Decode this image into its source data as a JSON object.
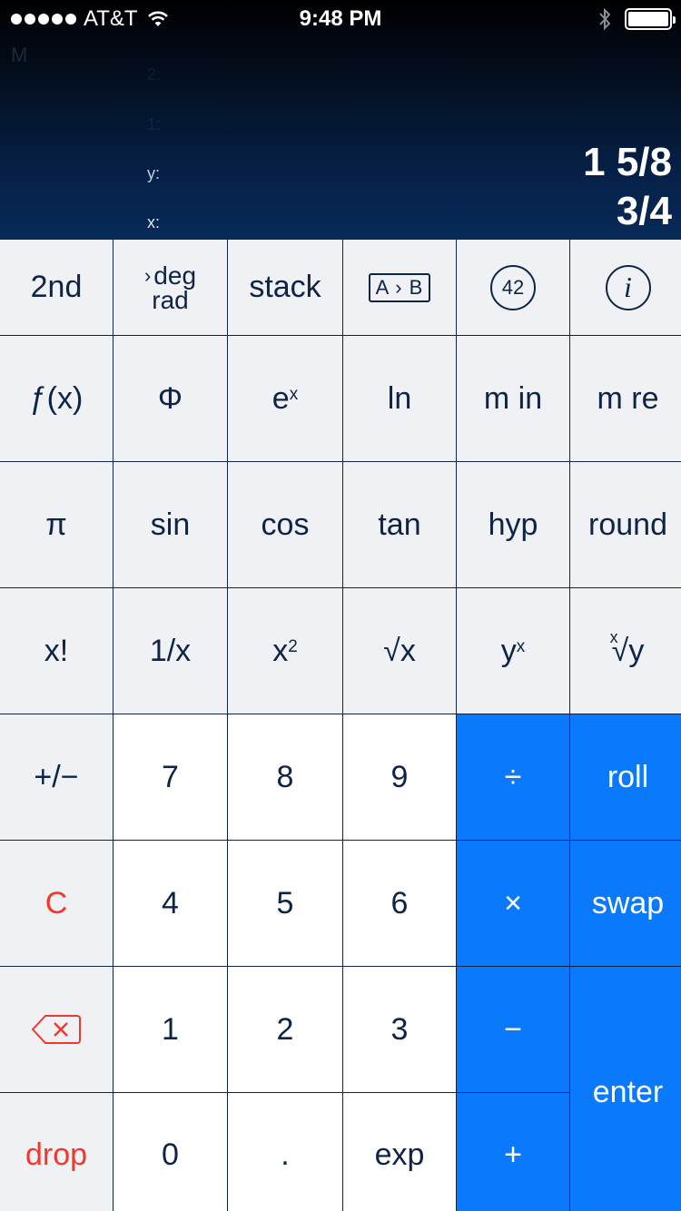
{
  "status_bar": {
    "carrier": "AT&T",
    "time": "9:48 PM",
    "icons": [
      "signal-dots-icon",
      "wifi-icon",
      "bluetooth-icon",
      "battery-icon"
    ]
  },
  "display": {
    "memory_indicator": "M",
    "registers": {
      "r2_label": "2:",
      "r1_label": "1:",
      "y_label": "y:",
      "x_label": "x:",
      "y_value": "1 5/8",
      "x_value": "3/4"
    }
  },
  "keys": {
    "second": "2nd",
    "deg": "deg",
    "rad": "rad",
    "stack": "stack",
    "a_to_b": "A › B",
    "forty_two": "42",
    "info": "i",
    "fx": "ƒ(x)",
    "phi": "Φ",
    "e": "e",
    "e_sup": "x",
    "ln": "ln",
    "m_in": "m in",
    "m_re": "m re",
    "pi": "π",
    "sin": "sin",
    "cos": "cos",
    "tan": "tan",
    "hyp": "hyp",
    "round": "round",
    "factorial": "x!",
    "reciprocal": "1/x",
    "square_base": "x",
    "square_sup": "2",
    "sqrt": "√x",
    "power_base": "y",
    "power_sup": "x",
    "nth_root_sup": "x",
    "nth_root_body": "√y",
    "plus_minus": "+/−",
    "seven": "7",
    "eight": "8",
    "nine": "9",
    "divide": "÷",
    "roll": "roll",
    "clear": "C",
    "four": "4",
    "five": "5",
    "six": "6",
    "multiply": "×",
    "swap": "swap",
    "one": "1",
    "two": "2",
    "three": "3",
    "minus": "−",
    "enter": "enter",
    "drop": "drop",
    "zero": "0",
    "dot": ".",
    "exp": "exp",
    "plus": "+"
  },
  "colors": {
    "accent": "#0a79fb",
    "key_text": "#0e2447",
    "danger": "#f0392b",
    "function_key_bg": "#eff1f4",
    "number_key_bg": "#ffffff"
  }
}
